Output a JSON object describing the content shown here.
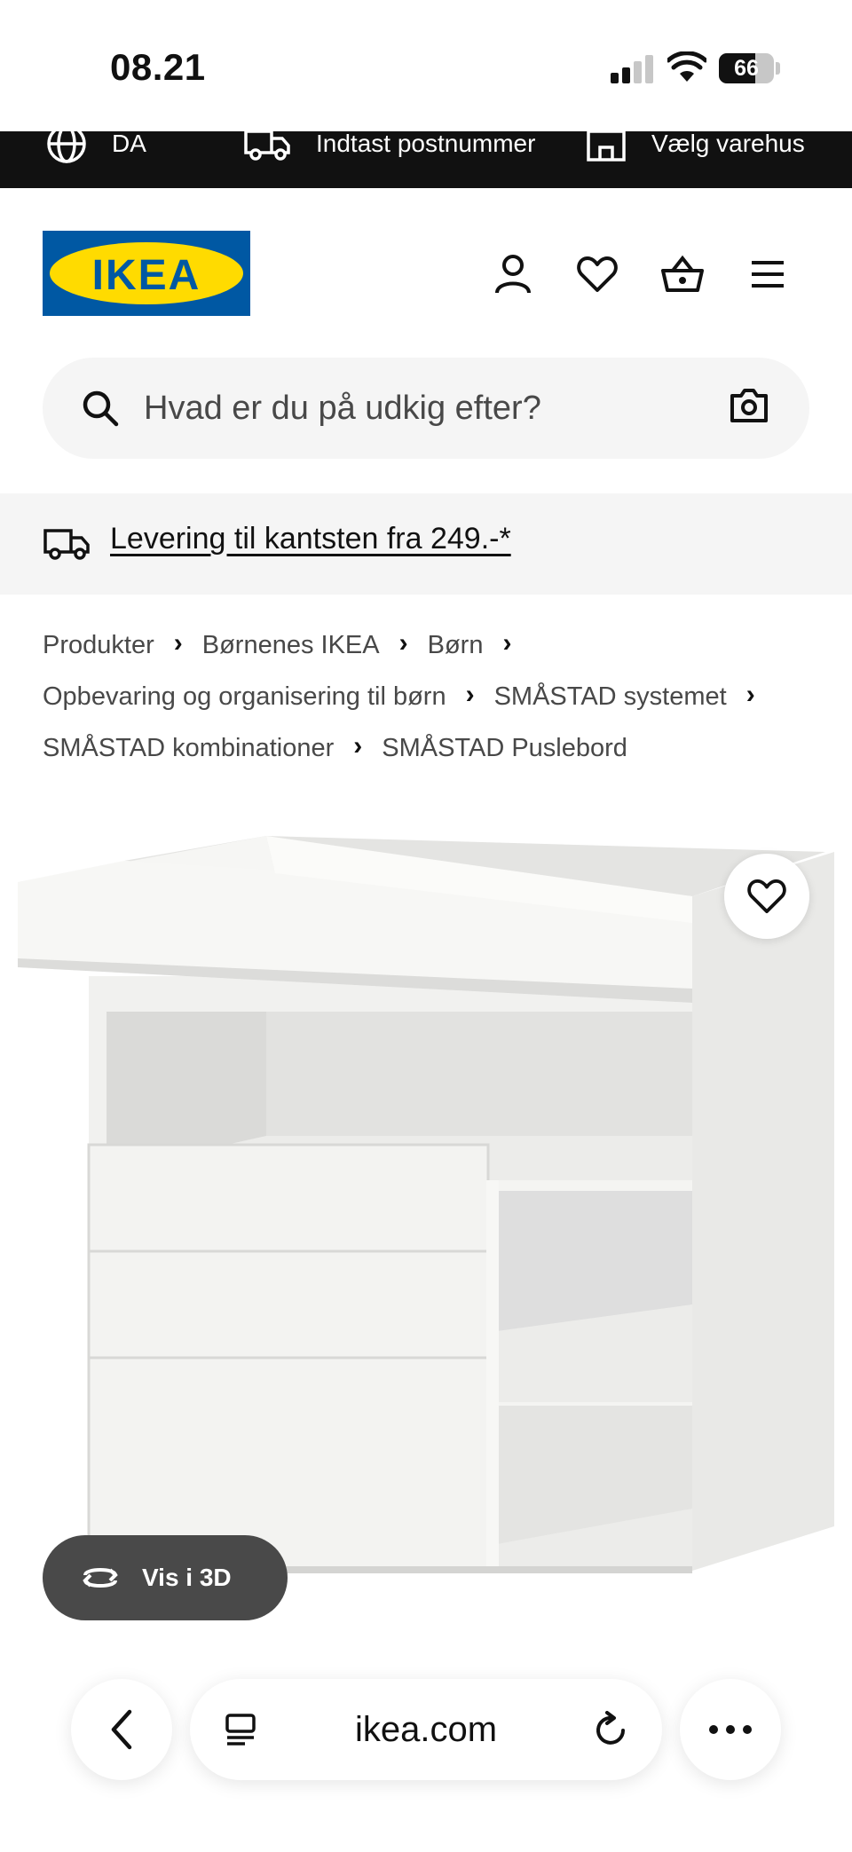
{
  "status_bar": {
    "time": "08.21",
    "battery": "66",
    "battery_level": 0.66
  },
  "topbar": {
    "language": "DA",
    "postcode": "Indtast postnummer",
    "store": "Vælg varehus"
  },
  "header": {
    "logo_text": "IKEA"
  },
  "search": {
    "placeholder": "Hvad er du på udkig efter?"
  },
  "banner": {
    "delivery_text": "Levering til kantsten fra 249.-*"
  },
  "breadcrumbs": [
    "Produkter",
    "Børnenes IKEA",
    "Børn",
    "Opbevaring og organisering til børn",
    "SMÅSTAD systemet",
    "SMÅSTAD kombinationer",
    "SMÅSTAD Puslebord"
  ],
  "product": {
    "view3d_label": "Vis i 3D"
  },
  "browser": {
    "url": "ikea.com"
  },
  "colors": {
    "ikea_blue": "#0058a3",
    "ikea_yellow": "#ffdb00",
    "topbar": "#111111",
    "pill": "#494949"
  }
}
